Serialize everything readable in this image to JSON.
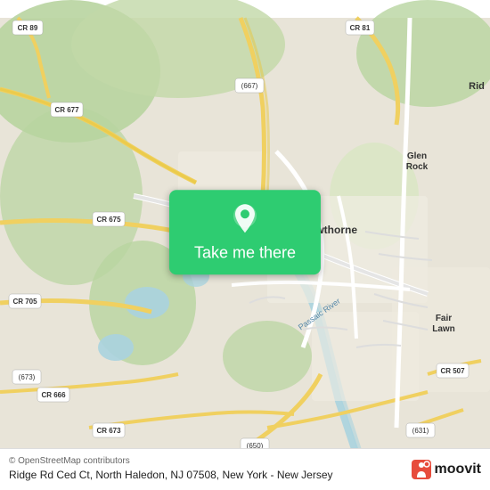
{
  "map": {
    "alt": "Map of Ridge Rd Ced Ct, North Haledon, NJ area"
  },
  "button": {
    "label": "Take me there"
  },
  "attribution": {
    "text": "© OpenStreetMap contributors"
  },
  "address": {
    "text": "Ridge Rd Ced Ct, North Haledon, NJ 07508, New York - New Jersey"
  },
  "moovit": {
    "name": "moovit"
  },
  "colors": {
    "button_bg": "#2ecc71",
    "button_text": "#ffffff"
  }
}
